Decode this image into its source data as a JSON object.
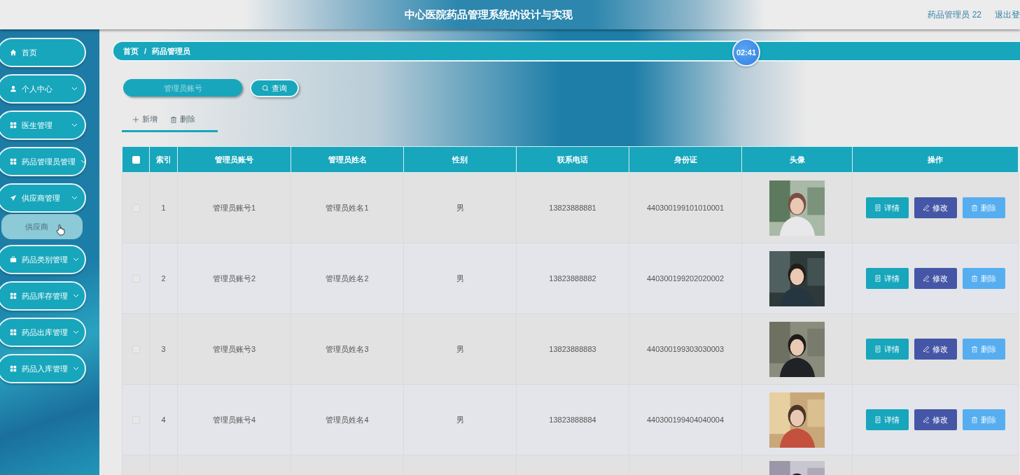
{
  "header": {
    "title": "中心医院药品管理系统的设计与实现",
    "user": "药品管理员 22",
    "logout": "退出登"
  },
  "sidebar": {
    "items": [
      {
        "label": "首页",
        "kind": "home",
        "chevron": false
      },
      {
        "label": "个人中心",
        "kind": "user",
        "chevron": true
      },
      {
        "label": "医生管理",
        "kind": "grid",
        "chevron": true
      },
      {
        "label": "药品管理员管理",
        "kind": "grid",
        "chevron": true
      },
      {
        "label": "供应商管理",
        "kind": "plane",
        "chevron": true,
        "children": [
          {
            "label": "供应商"
          }
        ]
      },
      {
        "label": "药品类别管理",
        "kind": "case",
        "chevron": true
      },
      {
        "label": "药品库存管理",
        "kind": "grid",
        "chevron": true
      },
      {
        "label": "药品出库管理",
        "kind": "grid",
        "chevron": true
      },
      {
        "label": "药品入库管理",
        "kind": "grid",
        "chevron": true
      }
    ]
  },
  "breadcrumb": {
    "items": [
      "首页",
      "药品管理员"
    ],
    "separator": "/"
  },
  "timer": "02:41",
  "search": {
    "placeholder": "管理员账号",
    "button": "查询"
  },
  "actions": [
    {
      "label": "新增",
      "kind": "add"
    },
    {
      "label": "删除",
      "kind": "delete"
    }
  ],
  "table": {
    "select_all": {
      "checked": false
    },
    "columns": [
      "索引",
      "管理员账号",
      "管理员姓名",
      "性别",
      "联系电话",
      "身份证",
      "头像",
      "操作"
    ],
    "rows": [
      {
        "checked": false,
        "cells": [
          "1",
          "管理员账号1",
          "管理员姓名1",
          "男",
          "13823888881",
          "440300199101010001"
        ],
        "avatar": {
          "kind": "picture"
        },
        "buttons": [
          {
            "label": "详情",
            "kind": "detail"
          },
          {
            "label": "修改",
            "kind": "edit"
          },
          {
            "label": "删除",
            "kind": "delete"
          }
        ]
      },
      {
        "checked": false,
        "cells": [
          "2",
          "管理员账号2",
          "管理员姓名2",
          "男",
          "13823888882",
          "440300199202020002"
        ],
        "avatar": {
          "kind": "picture"
        },
        "buttons": [
          {
            "label": "详情",
            "kind": "detail"
          },
          {
            "label": "修改",
            "kind": "edit"
          },
          {
            "label": "删除",
            "kind": "delete"
          }
        ]
      },
      {
        "checked": false,
        "cells": [
          "3",
          "管理员账号3",
          "管理员姓名3",
          "男",
          "13823888883",
          "440300199303030003"
        ],
        "avatar": {
          "kind": "picture"
        },
        "buttons": [
          {
            "label": "详情",
            "kind": "detail"
          },
          {
            "label": "修改",
            "kind": "edit"
          },
          {
            "label": "删除",
            "kind": "delete"
          }
        ]
      },
      {
        "checked": false,
        "cells": [
          "4",
          "管理员账号4",
          "管理员姓名4",
          "男",
          "13823888884",
          "440300199404040004"
        ],
        "avatar": {
          "kind": "picture"
        },
        "buttons": [
          {
            "label": "详情",
            "kind": "detail"
          },
          {
            "label": "修改",
            "kind": "edit"
          },
          {
            "label": "删除",
            "kind": "delete"
          }
        ]
      },
      {
        "avatar": {
          "kind": "picture"
        }
      }
    ]
  }
}
